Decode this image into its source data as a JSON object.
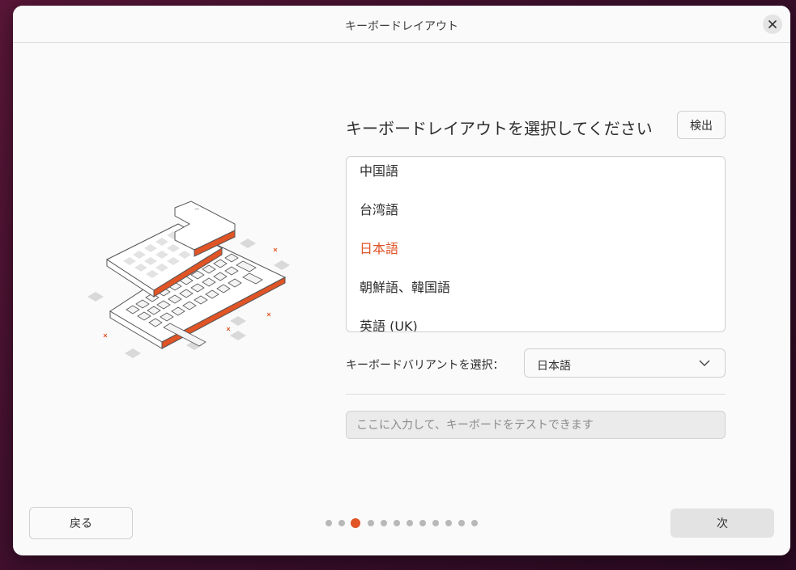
{
  "window": {
    "title": "キーボードレイアウト"
  },
  "main": {
    "heading": "キーボードレイアウトを選択してください",
    "detect_label": "検出",
    "layouts": [
      {
        "label": "中国語",
        "selected": false
      },
      {
        "label": "台湾語",
        "selected": false
      },
      {
        "label": "日本語",
        "selected": true
      },
      {
        "label": "朝鮮語、韓国語",
        "selected": false
      },
      {
        "label": "英語 (UK)",
        "selected": false
      }
    ],
    "variant_label": "キーボードバリアントを選択：",
    "variant_value": "日本語",
    "test_placeholder": "ここに入力して、キーボードをテストできます"
  },
  "footer": {
    "back_label": "戻る",
    "next_label": "次",
    "progress": {
      "total": 12,
      "current": 3
    }
  },
  "colors": {
    "accent": "#e05425",
    "window_bg": "#fafafa",
    "desktop_bg": "#4a1232"
  },
  "icons": {
    "close": "close-icon",
    "dropdown": "chevron-down-icon",
    "illustration": "keyboard-illustration"
  }
}
